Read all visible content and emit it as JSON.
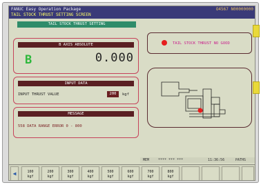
{
  "header": {
    "app_title": "FANUC Easy Operation Package",
    "screen_title": "TAIL STOCK THRUST SETTING SCREEN",
    "code": "O4567 N00000000"
  },
  "banner": "TAIL STOCK THRUST SETTING",
  "axis_panel": {
    "title": "B AXIS ABSOLUTE",
    "axis": "B",
    "value": "0.000"
  },
  "input_panel": {
    "title": "INPUT DATA",
    "label": "INPUT THRUST VALUE",
    "value": "200",
    "unit": "kgf"
  },
  "message_panel": {
    "title": "MESSAGE",
    "text": "558 DATA RANGE ERROR  0 - 800"
  },
  "status": {
    "text": "TAIL STOCK THRUST NO GOOD",
    "indicator_color": "#e61e1e"
  },
  "status_line": {
    "mode": "MEM",
    "stars": "**** *** ***",
    "time": "11:36:56",
    "label": "PATHS"
  },
  "softkeys": [
    {
      "value": "100",
      "unit": "kgf"
    },
    {
      "value": "200",
      "unit": "kgf"
    },
    {
      "value": "300",
      "unit": "kgf"
    },
    {
      "value": "400",
      "unit": "kgf"
    },
    {
      "value": "500",
      "unit": "kgf"
    },
    {
      "value": "600",
      "unit": "kgf"
    },
    {
      "value": "700",
      "unit": "kgf"
    },
    {
      "value": "800",
      "unit": "kgf"
    }
  ],
  "icons": {
    "nav": "left-arrow-icon"
  },
  "colors": {
    "header": "#3a3a78",
    "panel_border": "#c6425a",
    "banner": "#2f8c6a",
    "axis_letter": "#2eb83c"
  }
}
